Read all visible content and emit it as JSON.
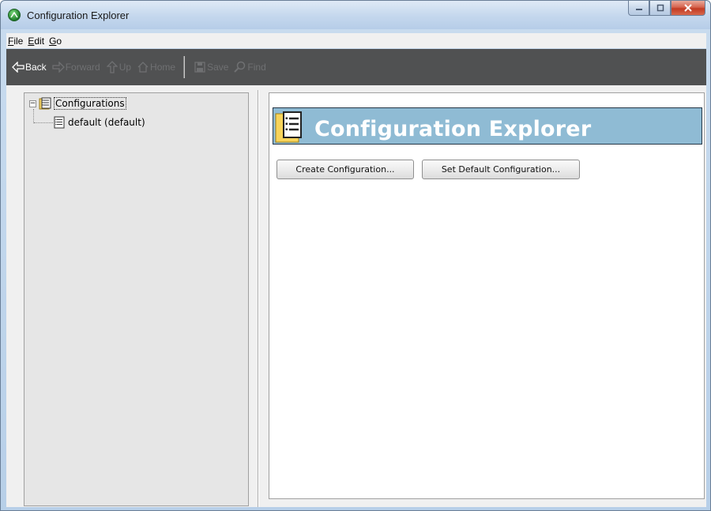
{
  "window": {
    "title": "Configuration Explorer",
    "controls": {
      "minimize": "–",
      "maximize": "□",
      "close": "X"
    }
  },
  "menubar": {
    "items": [
      {
        "underline": "F",
        "rest": "ile"
      },
      {
        "underline": "E",
        "rest": "dit"
      },
      {
        "underline": "G",
        "rest": "o"
      }
    ]
  },
  "toolbar": {
    "back": "Back",
    "forward": "Forward",
    "up": "Up",
    "home": "Home",
    "save": "Save",
    "find": "Find"
  },
  "tree": {
    "root_label": "Configurations",
    "expander": "−",
    "children": [
      "default (default)"
    ]
  },
  "content": {
    "banner_title": "Configuration Explorer",
    "create_button": "Create Configuration...",
    "set_default_button": "Set Default Configuration..."
  },
  "colors": {
    "banner": "#8fbbd4",
    "toolbar": "#505152",
    "left_pane": "#e6e6e6"
  }
}
